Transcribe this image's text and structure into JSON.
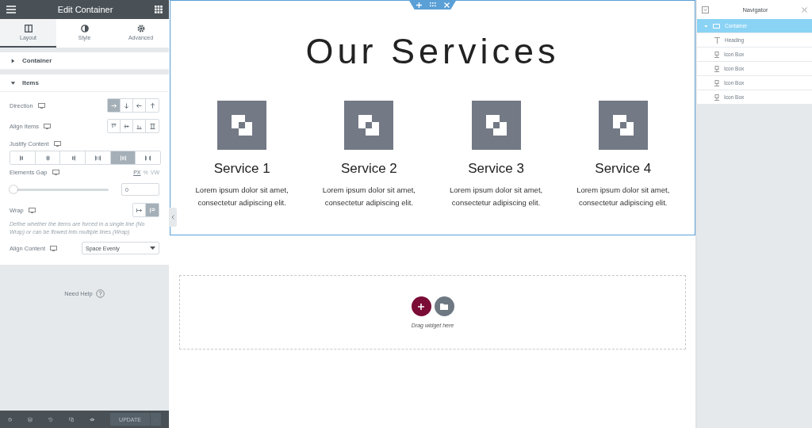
{
  "panel": {
    "title": "Edit Container",
    "tabs": [
      {
        "label": "Layout",
        "selected": true,
        "kind": "columns"
      },
      {
        "label": "Style",
        "selected": false,
        "kind": "contrast"
      },
      {
        "label": "Advanced",
        "selected": false,
        "kind": "gear"
      }
    ],
    "sections": [
      {
        "label": "Container",
        "expanded": false
      },
      {
        "label": "Items",
        "expanded": true
      }
    ],
    "direction": {
      "label": "Direction",
      "options": [
        {
          "selected": true
        },
        {
          "selected": false
        },
        {
          "selected": false
        },
        {
          "selected": false
        }
      ]
    },
    "align_items": {
      "label": "Align Items",
      "options": [
        {
          "selected": false
        },
        {
          "selected": false
        },
        {
          "selected": false
        },
        {
          "selected": false
        }
      ]
    },
    "justify_content": {
      "label": "Justify Content",
      "options": [
        {
          "selected": false
        },
        {
          "selected": false
        },
        {
          "selected": false
        },
        {
          "selected": false
        },
        {
          "selected": true
        },
        {
          "selected": false
        }
      ]
    },
    "elements_gap": {
      "label": "Elements Gap",
      "units": [
        {
          "label": "PX",
          "selected": true
        },
        {
          "label": "%",
          "selected": false
        },
        {
          "label": "VW",
          "selected": false
        }
      ],
      "level": 0,
      "value": "0"
    },
    "wrap": {
      "label": "Wrap",
      "options": [
        {
          "selected": false
        },
        {
          "selected": true
        }
      ],
      "help": "Define whether the items are forced in a single line (No Wrap) or can be flowed into multiple lines (Wrap)"
    },
    "align_content": {
      "label": "Align Content",
      "value": "Space Evenly"
    },
    "need_help": "Need Help",
    "footer": {
      "button": "UPDATE"
    }
  },
  "canvas": {
    "heading": "Our Services",
    "services": [
      {
        "title": "Service 1",
        "text": "Lorem ipsum dolor sit amet, consectetur adipiscing elit."
      },
      {
        "title": "Service 2",
        "text": "Lorem ipsum dolor sit amet, consectetur adipiscing elit."
      },
      {
        "title": "Service 3",
        "text": "Lorem ipsum dolor sit amet, consectetur adipiscing elit."
      },
      {
        "title": "Service 4",
        "text": "Lorem ipsum dolor sit amet, consectetur adipiscing elit."
      }
    ],
    "drop_zone": "Drag widget here"
  },
  "navigator": {
    "title": "Navigator",
    "items": [
      {
        "label": "Container",
        "kind": "container",
        "selected": true,
        "expanded": true,
        "children": [
          {
            "label": "Heading",
            "kind": "heading",
            "selected": false
          },
          {
            "label": "Icon Box",
            "kind": "iconbox",
            "selected": false
          },
          {
            "label": "Icon Box",
            "kind": "iconbox",
            "selected": false
          },
          {
            "label": "Icon Box",
            "kind": "iconbox",
            "selected": false
          },
          {
            "label": "Icon Box",
            "kind": "iconbox",
            "selected": false
          }
        ]
      }
    ]
  }
}
